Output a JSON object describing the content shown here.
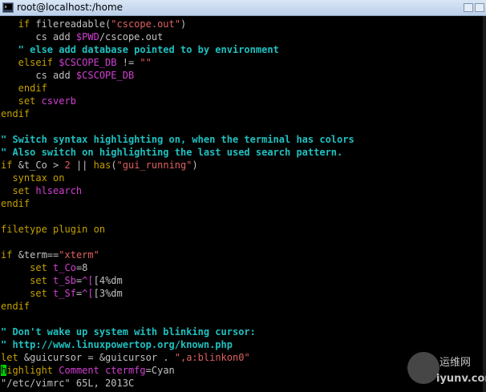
{
  "window": {
    "title": "root@localhost:/home",
    "icon": "terminal-icon"
  },
  "editor": {
    "lines": [
      [
        [
          "kw",
          "   if "
        ],
        [
          "wh",
          "filereadable("
        ],
        [
          "str",
          "\"cscope.out\""
        ],
        [
          "wh",
          ")"
        ]
      ],
      [
        [
          "wh",
          "      cs add "
        ],
        [
          "var",
          "$PWD"
        ],
        [
          "wh",
          "/cscope.out"
        ]
      ],
      [
        [
          "cm",
          "   \" else add database pointed to by environment"
        ]
      ],
      [
        [
          "kw",
          "   elseif "
        ],
        [
          "var",
          "$CSCOPE_DB"
        ],
        [
          "wh",
          " != "
        ],
        [
          "str",
          "\"\""
        ]
      ],
      [
        [
          "wh",
          "      cs add "
        ],
        [
          "var",
          "$CSCOPE_DB"
        ]
      ],
      [
        [
          "kw",
          "   endif"
        ]
      ],
      [
        [
          "kw",
          "   set "
        ],
        [
          "var",
          "csverb"
        ]
      ],
      [
        [
          "kw",
          "endif"
        ]
      ],
      [
        [
          "wh",
          ""
        ]
      ],
      [
        [
          "cm",
          "\" Switch syntax highlighting on, when the terminal has colors"
        ]
      ],
      [
        [
          "cm",
          "\" Also switch on highlighting the last used search pattern."
        ]
      ],
      [
        [
          "kw",
          "if "
        ],
        [
          "wh",
          "&t_Co > "
        ],
        [
          "str",
          "2"
        ],
        [
          "wh",
          " || "
        ],
        [
          "kw",
          "has"
        ],
        [
          "wh",
          "("
        ],
        [
          "str",
          "\"gui_running\""
        ],
        [
          "wh",
          ")"
        ]
      ],
      [
        [
          "kw",
          "  syntax "
        ],
        [
          "val",
          "on"
        ]
      ],
      [
        [
          "kw",
          "  set "
        ],
        [
          "var",
          "hlsearch"
        ]
      ],
      [
        [
          "kw",
          "endif"
        ]
      ],
      [
        [
          "wh",
          ""
        ]
      ],
      [
        [
          "kw",
          "filetype "
        ],
        [
          "val",
          "plugin on"
        ]
      ],
      [
        [
          "wh",
          ""
        ]
      ],
      [
        [
          "kw",
          "if "
        ],
        [
          "wh",
          "&term=="
        ],
        [
          "str",
          "\"xterm\""
        ]
      ],
      [
        [
          "kw",
          "     set "
        ],
        [
          "var",
          "t_Co"
        ],
        [
          "wh",
          "=8"
        ]
      ],
      [
        [
          "kw",
          "     set "
        ],
        [
          "var",
          "t_Sb"
        ],
        [
          "wh",
          "="
        ],
        [
          "var",
          "^["
        ],
        [
          "wh",
          "[4%dm"
        ]
      ],
      [
        [
          "kw",
          "     set "
        ],
        [
          "var",
          "t_Sf"
        ],
        [
          "wh",
          "="
        ],
        [
          "var",
          "^["
        ],
        [
          "wh",
          "[3%dm"
        ]
      ],
      [
        [
          "kw",
          "endif"
        ]
      ],
      [
        [
          "wh",
          ""
        ]
      ],
      [
        [
          "cm",
          "\" Don't wake up system with blinking cursor:"
        ]
      ],
      [
        [
          "cm",
          "\" http://www.linuxpowertop.org/known.php"
        ]
      ],
      [
        [
          "kw",
          "let "
        ],
        [
          "wh",
          "&guicursor = &guicursor . "
        ],
        [
          "str",
          "\",a:blinkon0\""
        ]
      ],
      [
        [
          "cursor",
          "h"
        ],
        [
          "kw",
          "ighlight "
        ],
        [
          "var",
          "Comment "
        ],
        [
          "var",
          "ctermfg"
        ],
        [
          "wh",
          "=Cyan"
        ]
      ],
      [
        [
          "wh",
          "\"/etc/vimrc\" 65L, 2013C"
        ]
      ]
    ]
  },
  "watermark": {
    "cn": "运维网",
    "en": "iyunv.com"
  },
  "colors": {
    "background": "#000000",
    "keyword": "#c4a000",
    "string": "#e06060",
    "variable": "#d040d0",
    "comment": "#20c0c0",
    "cursor": "#00d000"
  }
}
